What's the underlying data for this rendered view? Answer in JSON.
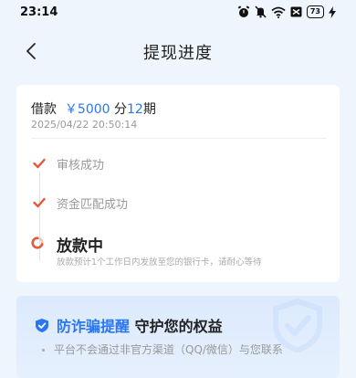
{
  "status_bar": {
    "time": "23:14",
    "battery": "73"
  },
  "header": {
    "title": "提现进度"
  },
  "loan": {
    "prefix": "借款",
    "amount": "￥5000",
    "term_prefix": "分",
    "term_count": "12",
    "term_suffix": "期",
    "date": "2025/04/22 20:50:14"
  },
  "steps": [
    {
      "label": "审核成功",
      "status": "done"
    },
    {
      "label": "资金匹配成功",
      "status": "done"
    },
    {
      "label": "放款中",
      "status": "in-progress",
      "description": "放款预计1个工作日内发放至您的银行卡，请耐心等待"
    }
  ],
  "notice": {
    "title_highlight": "防诈骗提醒",
    "title_rest": "守护您的权益",
    "items": [
      "平台不会通过非官方渠道（QQ/微信）与您联系"
    ]
  },
  "colors": {
    "accent": "#2a76f2",
    "check": "#e8583a",
    "background": "#eef5fd"
  }
}
